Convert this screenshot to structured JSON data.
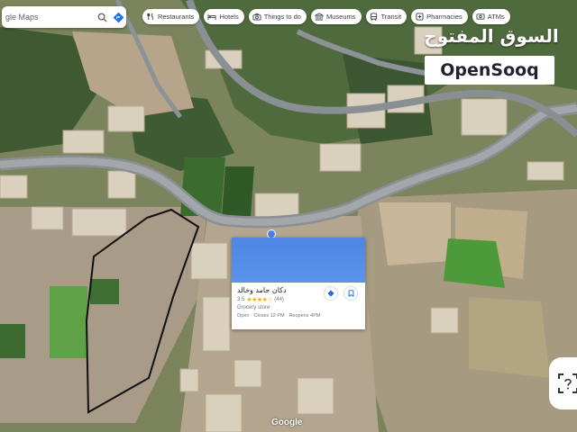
{
  "search": {
    "text": "gle Maps",
    "icons": [
      "search-icon",
      "directions-icon"
    ]
  },
  "categories": [
    {
      "label": "Restaurants",
      "icon": "restaurant-icon"
    },
    {
      "label": "Hotels",
      "icon": "hotel-icon"
    },
    {
      "label": "Things to do",
      "icon": "camera-icon"
    },
    {
      "label": "Museums",
      "icon": "museum-icon"
    },
    {
      "label": "Transit",
      "icon": "transit-icon"
    },
    {
      "label": "Pharmacies",
      "icon": "pharmacy-icon"
    },
    {
      "label": "ATMs",
      "icon": "atm-icon"
    }
  ],
  "watermark": {
    "arabic": "السوق المفتوح",
    "latin": "OpenSooq"
  },
  "place_card": {
    "name": "دكان حامد وخالد",
    "rating": "3.5",
    "stars": "★★★★☆",
    "reviews": "(44)",
    "category": "Grocery store",
    "hours": "Open · Closes 12 PM · Reopens 4PM"
  },
  "attribution": "Google",
  "colors": {
    "road": "#8a8f94",
    "boundary": "#111111",
    "card_header": "#4d86e3",
    "star": "#f9ab00"
  }
}
